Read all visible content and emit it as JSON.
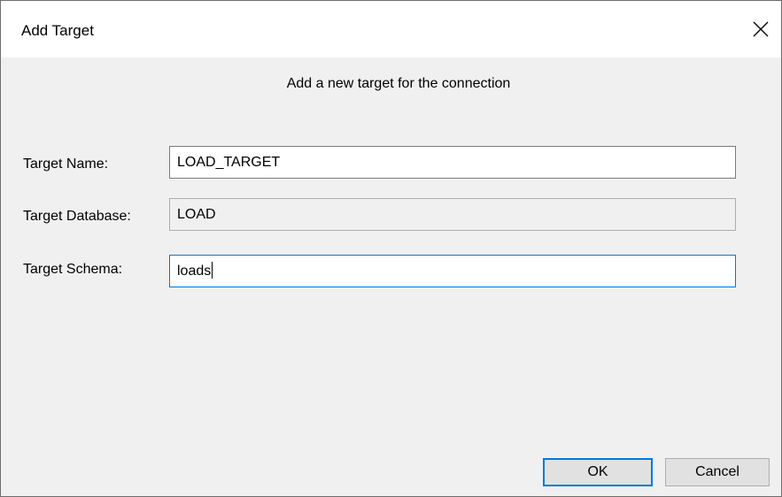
{
  "dialog": {
    "title": "Add Target",
    "close_icon": "close-icon",
    "subtitle": "Add a new target for the connection"
  },
  "fields": {
    "target_name": {
      "label": "Target Name:",
      "value": "LOAD_TARGET"
    },
    "target_database": {
      "label": "Target Database:",
      "value": "LOAD"
    },
    "target_schema": {
      "label": "Target Schema:",
      "value": "loads"
    }
  },
  "buttons": {
    "ok_label": "OK",
    "cancel_label": "Cancel"
  },
  "colors": {
    "focus_accent": "#0078d7",
    "dialog_background": "#f0f0f0",
    "titlebar_background": "#ffffff"
  }
}
